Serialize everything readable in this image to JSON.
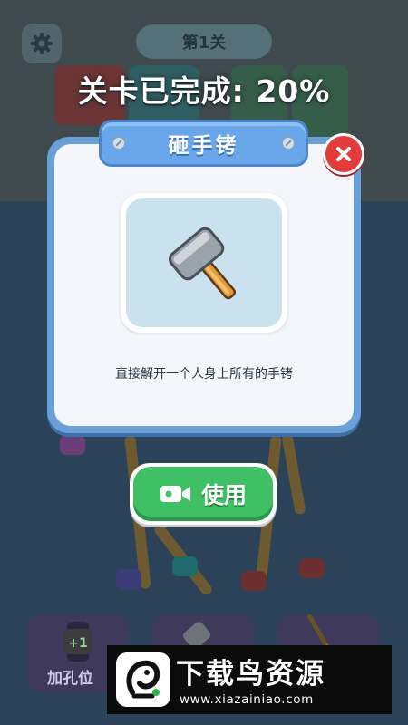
{
  "hud": {
    "level_label": "第1关",
    "progress_title": "关卡已完成: 20%",
    "settings_icon": "gear-icon"
  },
  "background": {
    "box_cards": [
      "盒子",
      "盒子"
    ],
    "tools": [
      {
        "label": "加孔位",
        "icon": "watch-plus-one-icon"
      },
      {
        "label": "",
        "icon": "hammer-icon"
      },
      {
        "label": "",
        "icon": "broom-icon"
      }
    ]
  },
  "dialog": {
    "title": "砸手铐",
    "item_icon": "hammer-icon",
    "description": "直接解开一个人身上所有的手铐",
    "close_icon": "close-icon"
  },
  "action": {
    "use_label": "使用",
    "use_icon": "video-camera-icon"
  },
  "watermark": {
    "title": "下载鸟资源",
    "url": "www.xiazainiao.com"
  },
  "colors": {
    "dialog_border": "#6a9fd8",
    "banner": "#6aa6ea",
    "close_red": "#e23c3c",
    "use_green": "#3fc064",
    "item_well": "#c9e2ee"
  }
}
